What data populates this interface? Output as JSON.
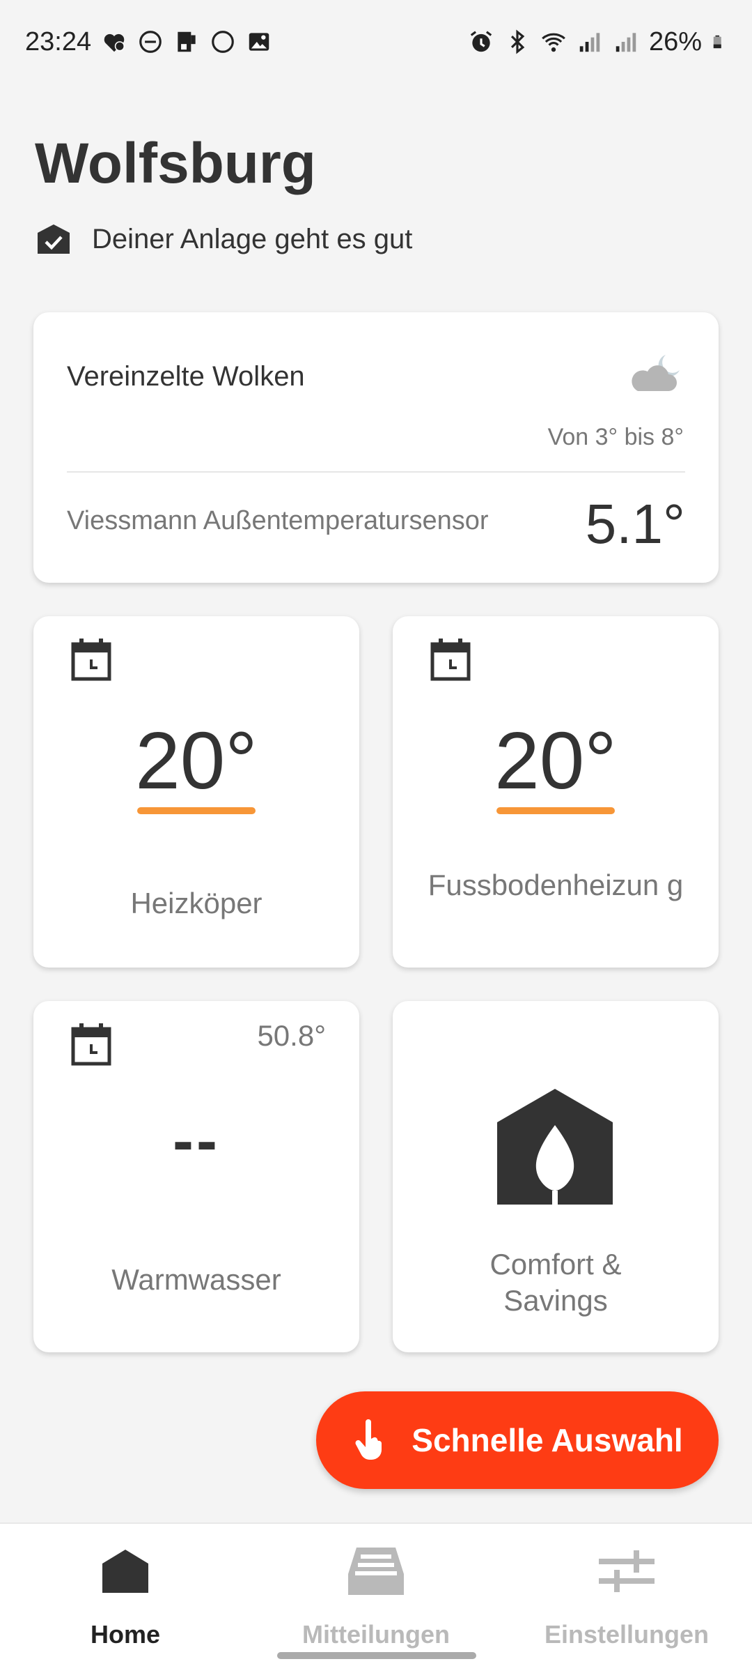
{
  "status_bar": {
    "time": "23:24",
    "battery": "26%",
    "icons_left": [
      "heart-gear-icon",
      "do-not-disturb-icon",
      "sim-icon",
      "circle-icon",
      "image-icon"
    ],
    "icons_right": [
      "alarm-icon",
      "bluetooth-icon",
      "wifi-icon",
      "signal-icon",
      "signal-icon",
      "battery-icon"
    ]
  },
  "header": {
    "title": "Wolfsburg",
    "system_status": "Deiner Anlage geht es gut"
  },
  "weather": {
    "description": "Vereinzelte Wolken",
    "icon": "cloud-moon-icon",
    "range": "Von 3° bis 8°",
    "sensor_label": "Viessmann Außentemperatursensor",
    "sensor_value": "5.1°"
  },
  "tiles": {
    "heizkoerper": {
      "temp": "20°",
      "label": "Heizköper",
      "icon": "calendar-clock-icon"
    },
    "fussboden": {
      "temp": "20°",
      "label": "Fussbodenheizun g",
      "icon": "calendar-clock-icon"
    },
    "warmwasser": {
      "temp": "50.8°",
      "value": "--",
      "label": "Warmwasser",
      "icon": "calendar-clock-icon"
    },
    "comfort": {
      "label": "Comfort & Savings",
      "icon": "house-flame-icon"
    }
  },
  "fab": {
    "label": "Schnelle Auswahl",
    "icon": "hand-pointer-icon"
  },
  "nav": {
    "home": "Home",
    "messages": "Mitteilungen",
    "settings": "Einstellungen"
  },
  "colors": {
    "accent_orange": "#f79637",
    "fab_red": "#fe3c14",
    "text_dark": "#333333",
    "text_muted": "#777777",
    "nav_inactive": "#b9b9b9"
  }
}
